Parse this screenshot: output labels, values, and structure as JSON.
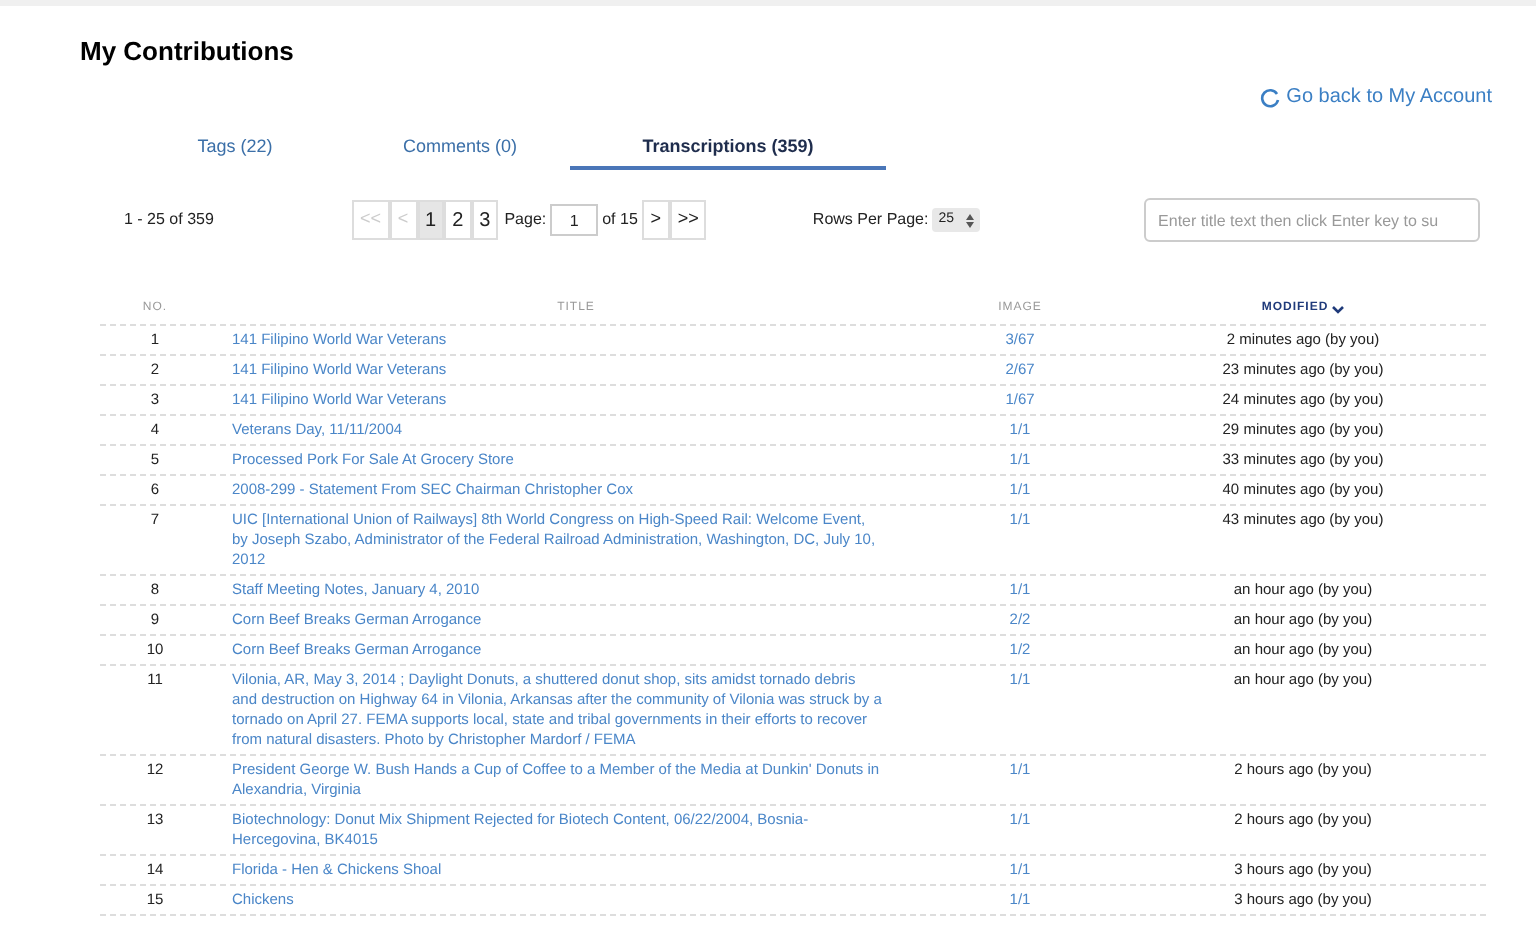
{
  "page_title": "My Contributions",
  "back_link": "Go back to My Account",
  "tabs": [
    {
      "label": "Tags (22)",
      "selected": false
    },
    {
      "label": "Comments (0)",
      "selected": false
    },
    {
      "label": "Transcriptions (359)",
      "selected": true
    }
  ],
  "pagination": {
    "range": "1 - 25 of 359",
    "buttons": [
      {
        "label": "<<",
        "disabled": true
      },
      {
        "label": "<",
        "disabled": true
      }
    ],
    "pages": [
      {
        "label": "1",
        "selected": true
      },
      {
        "label": "2",
        "selected": false
      },
      {
        "label": "3",
        "selected": false
      }
    ],
    "page_label": "Page:",
    "page_value": "1",
    "of_total": "of 15",
    "next_buttons": [
      {
        "label": ">",
        "disabled": false
      },
      {
        "label": ">>",
        "disabled": false
      }
    ]
  },
  "rows_per_page": {
    "label": "Rows Per Page:",
    "value": "25"
  },
  "search": {
    "placeholder": "Enter title text then click Enter key to su"
  },
  "table": {
    "columns": [
      {
        "label": "NO.",
        "sorted": false
      },
      {
        "label": "TITLE",
        "sorted": false
      },
      {
        "label": "IMAGE",
        "sorted": false
      },
      {
        "label": "MODIFIED",
        "sorted": true
      }
    ],
    "rows": [
      {
        "no": "1",
        "title": "141 Filipino World War Veterans",
        "image": "3/67",
        "modified": "2 minutes ago (by you)"
      },
      {
        "no": "2",
        "title": "141 Filipino World War Veterans",
        "image": "2/67",
        "modified": "23 minutes ago (by you)"
      },
      {
        "no": "3",
        "title": "141 Filipino World War Veterans",
        "image": "1/67",
        "modified": "24 minutes ago (by you)"
      },
      {
        "no": "4",
        "title": "Veterans Day, 11/11/2004",
        "image": "1/1",
        "modified": "29 minutes ago (by you)"
      },
      {
        "no": "5",
        "title": "Processed Pork For Sale At Grocery Store",
        "image": "1/1",
        "modified": "33 minutes ago (by you)"
      },
      {
        "no": "6",
        "title": "2008-299 - Statement From SEC Chairman Christopher Cox",
        "image": "1/1",
        "modified": "40 minutes ago (by you)"
      },
      {
        "no": "7",
        "title": "UIC [International Union of Railways] 8th World Congress on High-Speed Rail: Welcome Event, by Joseph Szabo, Administrator of the Federal Railroad Administration, Washington, DC, July 10, 2012",
        "image": "1/1",
        "modified": "43 minutes ago (by you)"
      },
      {
        "no": "8",
        "title": "Staff Meeting Notes, January 4, 2010",
        "image": "1/1",
        "modified": "an hour ago (by you)"
      },
      {
        "no": "9",
        "title": "Corn Beef Breaks German Arrogance",
        "image": "2/2",
        "modified": "an hour ago (by you)"
      },
      {
        "no": "10",
        "title": "Corn Beef Breaks German Arrogance",
        "image": "1/2",
        "modified": "an hour ago (by you)"
      },
      {
        "no": "11",
        "title": "Vilonia, AR, May 3, 2014 ; Daylight Donuts, a shuttered donut shop, sits amidst tornado debris and destruction on Highway 64 in Vilonia, Arkansas after the community of Vilonia was struck by a tornado on April 27. FEMA supports local, state and tribal governments in their efforts to recover from natural disasters. Photo by Christopher Mardorf / FEMA",
        "image": "1/1",
        "modified": "an hour ago (by you)"
      },
      {
        "no": "12",
        "title": "President George W. Bush Hands a Cup of Coffee to a Member of the Media at Dunkin' Donuts in Alexandria, Virginia",
        "image": "1/1",
        "modified": "2 hours ago (by you)"
      },
      {
        "no": "13",
        "title": "Biotechnology: Donut Mix Shipment Rejected for Biotech Content, 06/22/2004, Bosnia-Hercegovina, BK4015",
        "image": "1/1",
        "modified": "2 hours ago (by you)"
      },
      {
        "no": "14",
        "title": "Florida - Hen & Chickens Shoal",
        "image": "1/1",
        "modified": "3 hours ago (by you)"
      },
      {
        "no": "15",
        "title": "Chickens",
        "image": "1/1",
        "modified": "3 hours ago (by you)"
      }
    ]
  }
}
